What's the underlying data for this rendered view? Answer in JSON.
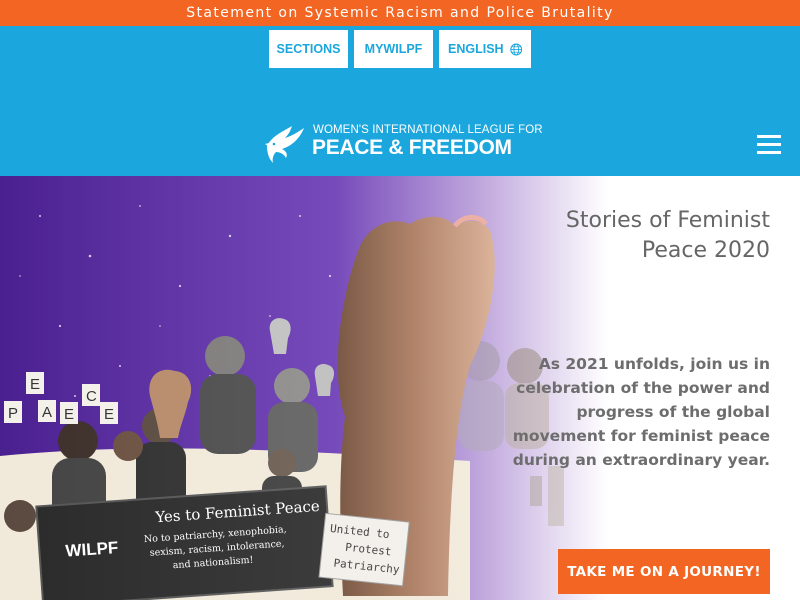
{
  "announcement": {
    "text": "Statement on Systemic Racism and Police Brutality"
  },
  "nav": {
    "sections_label": "SECTIONS",
    "mywilpf_label": "MYWILPF",
    "language_label": "ENGLISH"
  },
  "logo": {
    "line1": "WOMEN'S INTERNATIONAL LEAGUE FOR",
    "line2": "PEACE & FREEDOM"
  },
  "hero": {
    "title_line1": "Stories of Feminist",
    "title_line2": "Peace 2020",
    "body": "As 2021 unfolds, join us in celebration of the power and progress of the global movement for feminist peace during an extraordinary year.",
    "cta_label": "TAKE ME ON A JOURNEY!",
    "collage": {
      "sign_letters": [
        "E",
        "C",
        "A",
        "P",
        "E",
        "E"
      ],
      "banner_org": "WILPF",
      "banner_title": "Yes to Feminist Peace",
      "banner_line1": "No to patriarchy, xenophobia,",
      "banner_line2": "sexism, racism, intolerance,",
      "banner_line3": "and nationalism!",
      "placard_line1": "United to",
      "placard_line2": "Protest",
      "placard_line3": "Patriarchy"
    }
  },
  "colors": {
    "accent": "#f26522",
    "header_blue": "#1ba7dd",
    "hero_purple": "#5a2a9c"
  },
  "icons": {
    "language": "globe-icon",
    "logo": "dove-icon",
    "menu": "hamburger-menu-icon"
  }
}
